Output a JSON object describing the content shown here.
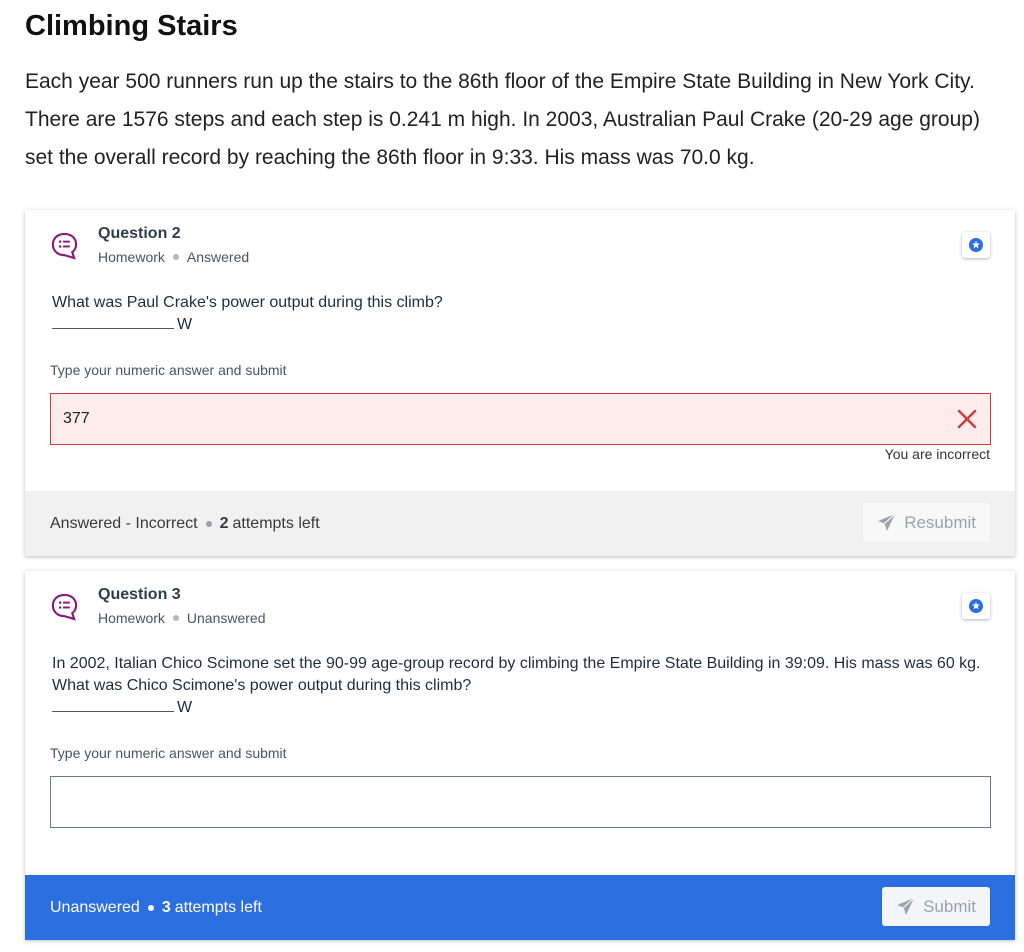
{
  "page": {
    "title": "Climbing Stairs",
    "intro": "Each year 500 runners run up the stairs to the 86th floor of the Empire State Building in New York City. There are 1576 steps and each step is 0.241 m high. In 2003, Australian Paul Crake (20-29 age group) set the overall record by reaching the 86th floor in 9:33. His mass was 70.0 kg."
  },
  "questions": [
    {
      "title": "Question 2",
      "category": "Homework",
      "state": "Answered",
      "text": "What was Paul Crake's power output during this climb?",
      "unit": "W",
      "input_label": "Type your numeric answer and submit",
      "answer": "377",
      "feedback": "You are incorrect",
      "footer_status": "Answered - Incorrect",
      "attempts_count": "2",
      "attempts_text": "attempts left",
      "button_label": "Resubmit"
    },
    {
      "title": "Question 3",
      "category": "Homework",
      "state": "Unanswered",
      "text": "In 2002, Italian Chico Scimone set the 90-99 age-group record by climbing the Empire State Building in 39:09. His mass was 60 kg. What was Chico Scimone's power output during this climb?",
      "unit": "W",
      "input_label": "Type your numeric answer and submit",
      "answer": "",
      "footer_status": "Unanswered",
      "attempts_count": "3",
      "attempts_text": "attempts left",
      "button_label": "Submit"
    }
  ],
  "colors": {
    "accent_blue": "#2b6ee0",
    "error_red": "#d0393e",
    "icon_purple": "#8a1a7a"
  },
  "icons": {
    "question": "chat-list-icon",
    "bookmark": "star-badge-icon",
    "incorrect": "close-icon",
    "submit": "paper-plane-icon"
  }
}
